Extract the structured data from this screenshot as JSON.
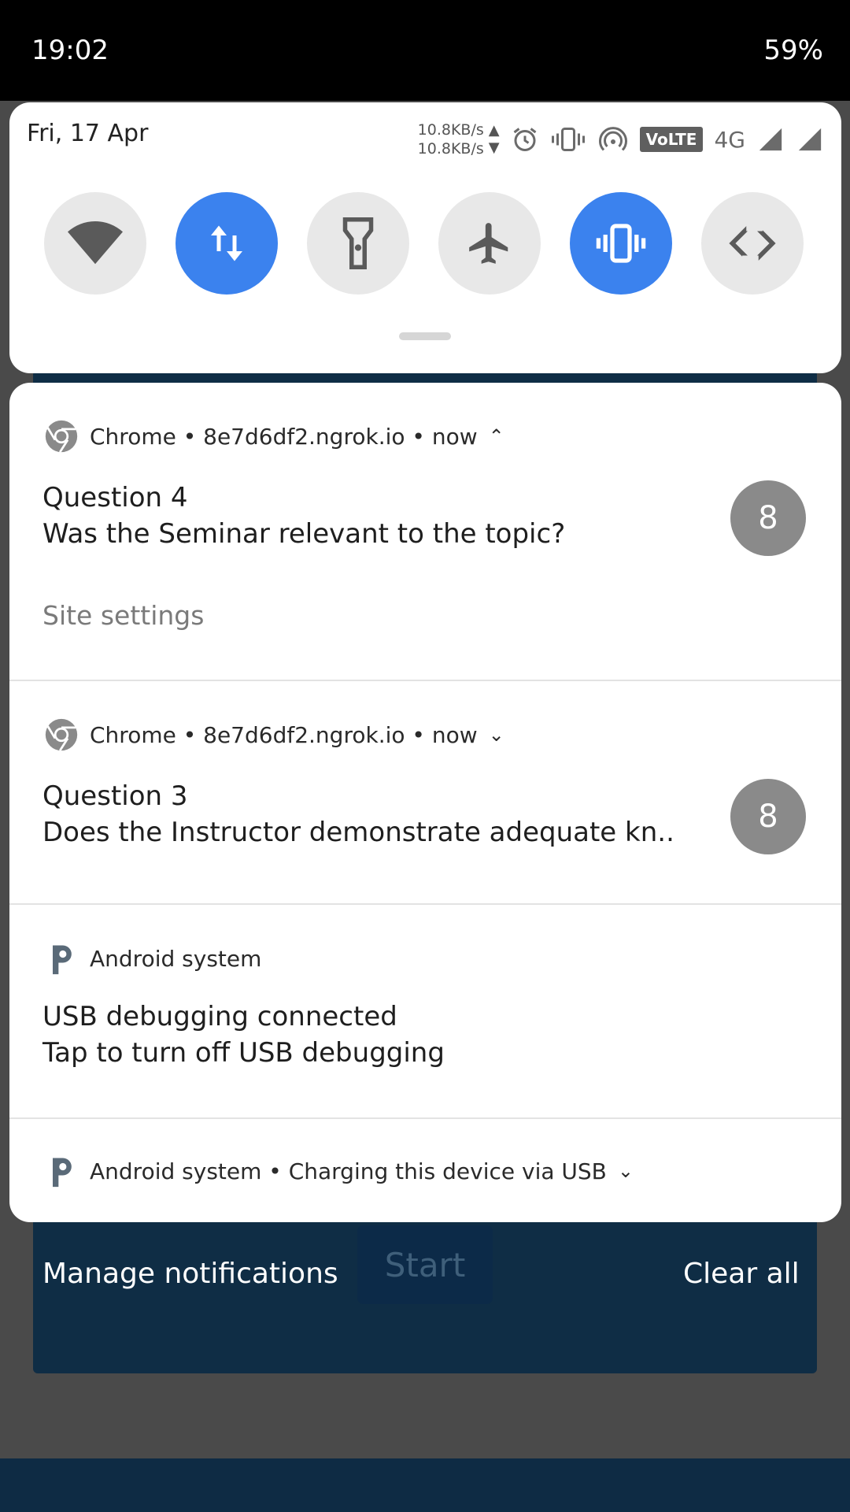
{
  "statusbar": {
    "time": "19:02",
    "battery": "59%"
  },
  "quick_settings": {
    "date": "Fri, 17 Apr",
    "netspeed_up": "10.8KB/s",
    "netspeed_down": "10.8KB/s",
    "volte_label": "VoLTE",
    "network_type": "4G",
    "tiles": [
      {
        "name": "wifi",
        "active": false
      },
      {
        "name": "mobile-data",
        "active": true
      },
      {
        "name": "flashlight",
        "active": false
      },
      {
        "name": "airplane-mode",
        "active": false
      },
      {
        "name": "vibrate",
        "active": true
      },
      {
        "name": "auto-rotate",
        "active": false
      }
    ],
    "colors": {
      "active_tile": "#3b82ee",
      "inactive_tile": "#e8e8e8"
    }
  },
  "notifications": [
    {
      "app_line": "Chrome • 8e7d6df2.ngrok.io • now",
      "title": "Question 4",
      "text": "Was the Seminar relevant to the topic?",
      "badge": "8",
      "action": "Site settings",
      "expanded": true
    },
    {
      "app_line": "Chrome • 8e7d6df2.ngrok.io • now",
      "title": "Question 3",
      "text": "Does the Instructor demonstrate adequate kn..",
      "badge": "8",
      "expanded": false
    },
    {
      "app_line": "Android system",
      "title": "USB debugging connected",
      "text": "Tap to turn off USB debugging"
    },
    {
      "app_line": "Android system • Charging this device via USB"
    }
  ],
  "actions": {
    "manage": "Manage notifications",
    "clear_all": "Clear all"
  },
  "background_app": {
    "start_label": "Start"
  }
}
